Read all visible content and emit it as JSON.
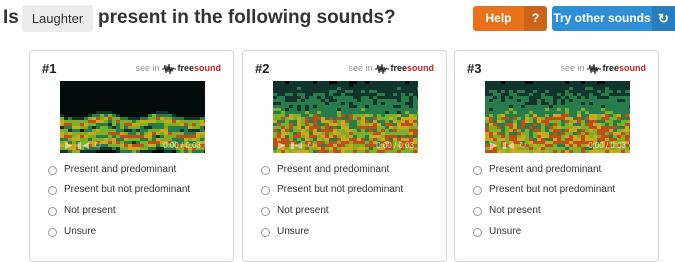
{
  "question": {
    "prefix": "Is",
    "tag": "Laughter",
    "suffix": "present in the following sounds?"
  },
  "buttons": {
    "help": {
      "label": "Help",
      "icon": "?"
    },
    "try_other": {
      "label": "Try other sounds",
      "icon": "↻"
    }
  },
  "colors": {
    "help": "#e8721c",
    "try_other": "#2e8fd6",
    "freesound_red": "#c0262d"
  },
  "cards": [
    {
      "number": "#1",
      "see_in": "see in",
      "brand_free": "free",
      "brand_sound": "sound",
      "time": "0:00 / 0:03",
      "variant": "banded"
    },
    {
      "number": "#2",
      "see_in": "see in",
      "brand_free": "free",
      "brand_sound": "sound",
      "time": "0:00 / 0:03",
      "variant": "dense"
    },
    {
      "number": "#3",
      "see_in": "see in",
      "brand_free": "free",
      "brand_sound": "sound",
      "time": "0:00 / 0:03",
      "variant": "dense"
    }
  ],
  "options": [
    "Present and predominant",
    "Present but not predominant",
    "Not present",
    "Unsure"
  ],
  "icons": {
    "radio": "radio-button",
    "play": "play-icon",
    "rewind": "rewind-icon",
    "loop": "loop-icon",
    "refresh": "refresh-icon"
  }
}
